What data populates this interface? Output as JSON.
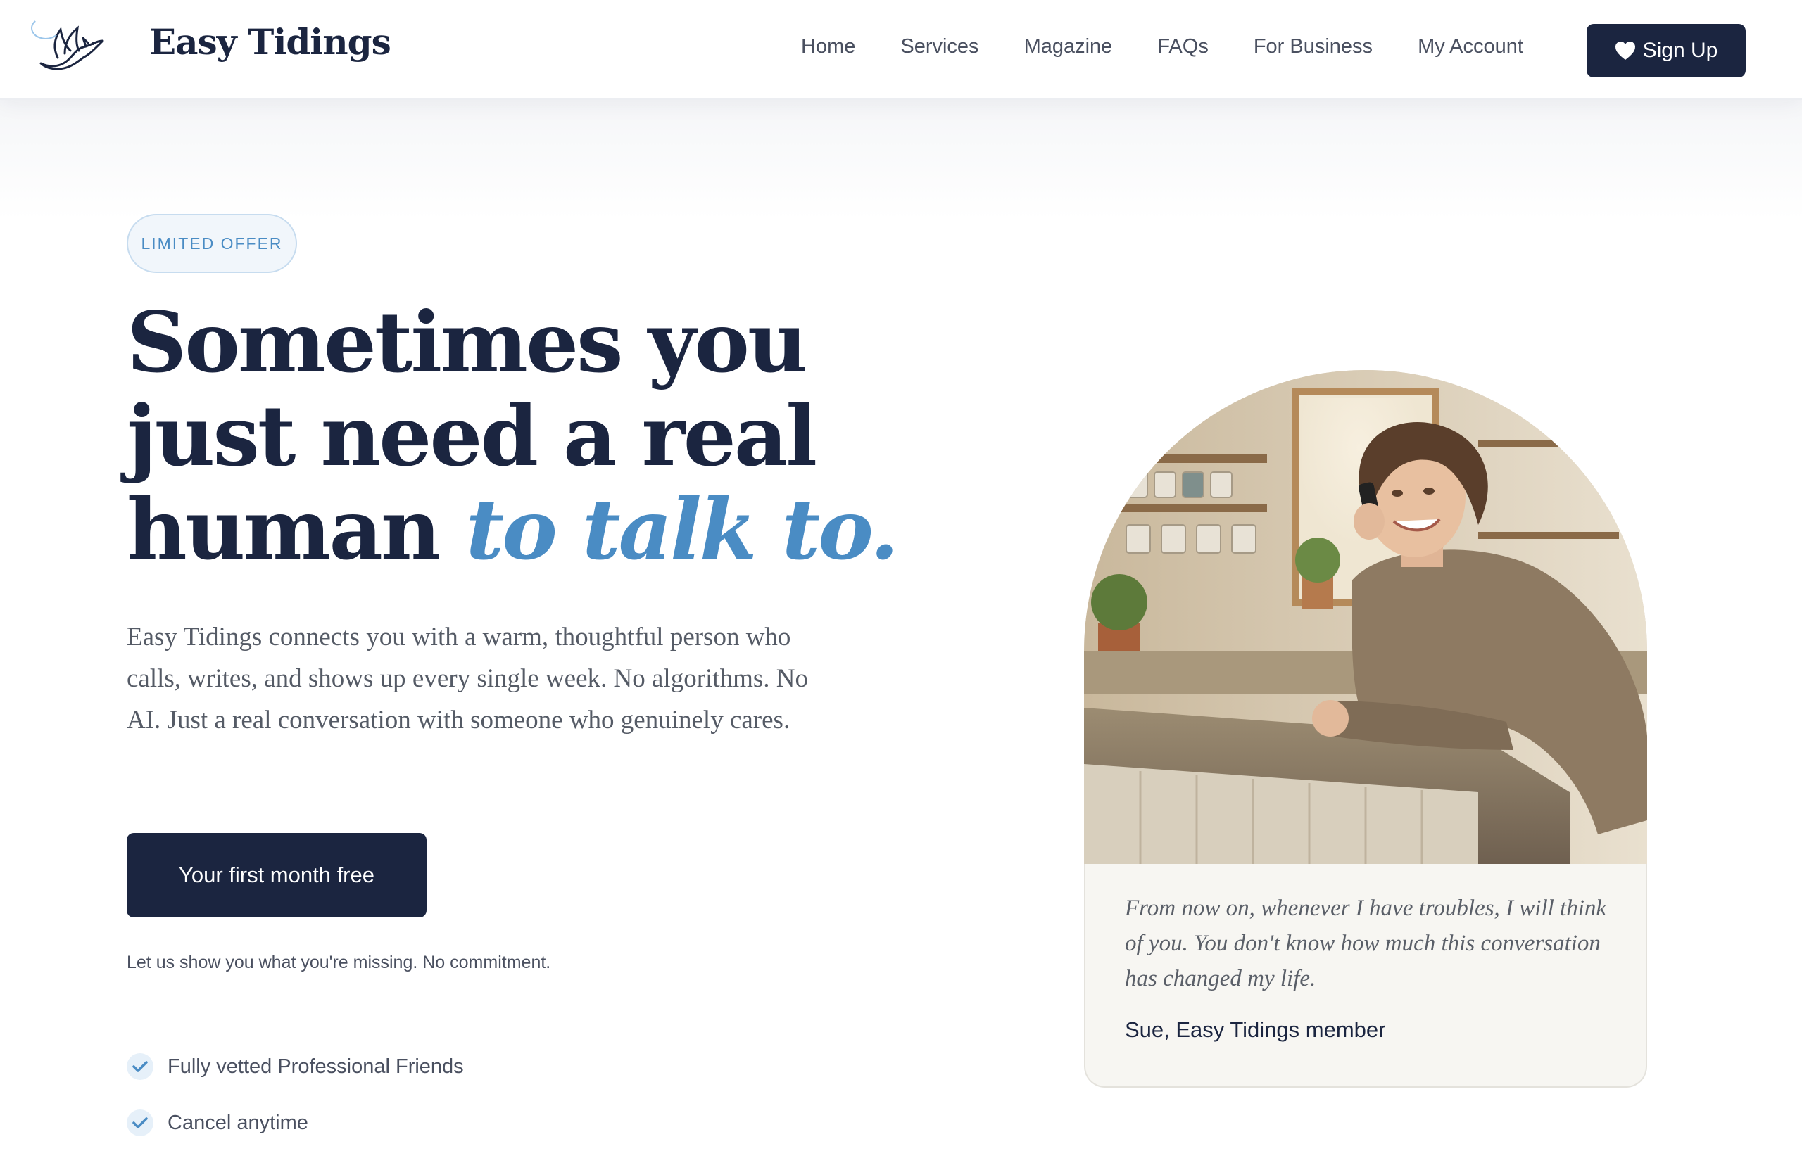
{
  "header": {
    "brand": "Easy Tidings",
    "nav": [
      "Home",
      "Services",
      "Magazine",
      "FAQs",
      "For Business",
      "My Account"
    ],
    "signup_label": "Sign Up"
  },
  "hero": {
    "badge": "LIMITED OFFER",
    "headline_main": "Sometimes you just need a real human",
    "headline_accent": "to talk to.",
    "lede": "Easy Tidings connects you with a warm, thoughtful person who calls, writes, and shows up every single week. No algorithms. No AI. Just a real conversation with someone who genuinely cares.",
    "cta_label": "Your first month free",
    "cta_note": "Let us show you what you're missing. No commitment.",
    "benefits": [
      "Fully vetted Professional Friends",
      "Cancel anytime"
    ]
  },
  "testimonial": {
    "quote": "From now on, whenever I have troubles, I will think of you. You don't know how much this conversation has changed my life.",
    "author": "Sue, Easy Tidings member"
  },
  "colors": {
    "navy": "#1b2540",
    "accent_blue": "#4a8cc4",
    "card_bg": "#f7f6f2"
  },
  "icons": {
    "logo": "dove-icon",
    "signup": "heart-icon",
    "benefit": "check-icon"
  }
}
